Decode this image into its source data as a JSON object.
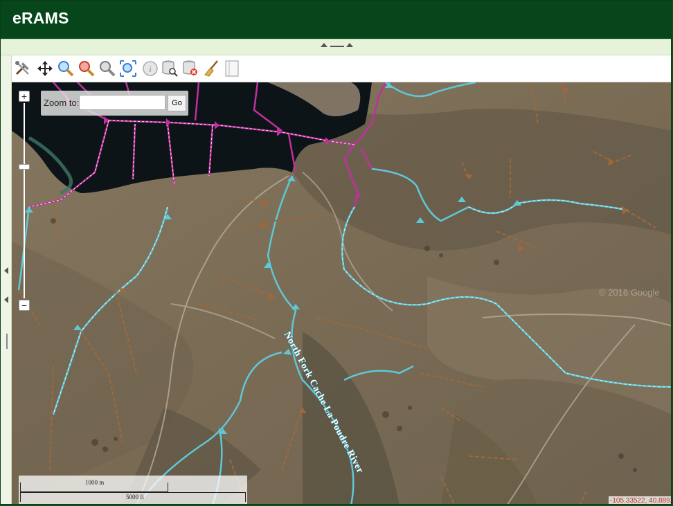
{
  "app": {
    "title": "eRAMS"
  },
  "toolbar": {
    "tools": [
      {
        "name": "tools-icon"
      },
      {
        "name": "pan-icon"
      },
      {
        "name": "zoom-in-icon"
      },
      {
        "name": "zoom-out-icon"
      },
      {
        "name": "zoom-previous-icon"
      },
      {
        "name": "zoom-extent-icon"
      },
      {
        "name": "info-icon"
      },
      {
        "name": "layer-query-icon"
      },
      {
        "name": "remove-layer-icon"
      },
      {
        "name": "clear-broom-icon"
      },
      {
        "name": "panel-toggle-icon"
      }
    ]
  },
  "map": {
    "zoom_to": {
      "label": "Zoom to:",
      "value": "",
      "placeholder": "",
      "go_label": "Go"
    },
    "zoom_controls": {
      "plus": "+",
      "minus": "−"
    },
    "scale_bar": {
      "metric": "1000 m",
      "imperial": "5000 ft"
    },
    "coordinates": "-105.33522, 40.88920",
    "watermark": "© 2016 Google",
    "river_label": "North Fork Cache La Poudre River",
    "colors": {
      "stream_cyan": "#5fc8d8",
      "stream_magenta": "#c0309e",
      "stream_brown": "#a0683a",
      "header_green": "#07461a"
    }
  }
}
